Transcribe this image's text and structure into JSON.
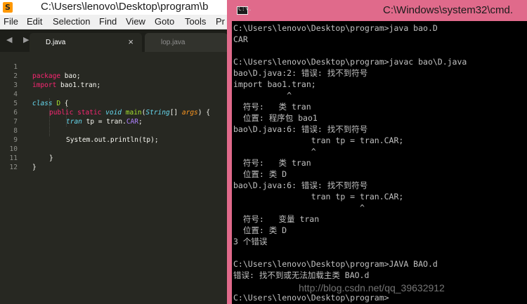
{
  "sublime": {
    "title": "C:\\Users\\lenovo\\Desktop\\program\\b",
    "app_icon": "S",
    "menu": [
      "File",
      "Edit",
      "Selection",
      "Find",
      "View",
      "Goto",
      "Tools",
      "Pr"
    ],
    "nav_arrows": "◀ ▶",
    "tabs": [
      {
        "label": "D.java",
        "close": "×"
      },
      {
        "label": "lop.java"
      }
    ],
    "lines": [
      "1",
      "2",
      "3",
      "4",
      "5",
      "6",
      "7",
      "8",
      "9",
      "10",
      "11",
      "12"
    ],
    "code": {
      "l1_kw": "package",
      "l1_rest": " bao;",
      "l2_kw": "import",
      "l2_rest": " bao1.tran;",
      "l4_kw": "class",
      "l4_name": " D",
      "l4_rest": " {",
      "l5_mod": "public",
      "l5_static": "static",
      "l5_void": "void",
      "l5_fn": "main",
      "l5_type": "String",
      "l5_arr": "[]",
      "l5_arg": "args",
      "l5_rest": ") {",
      "l6_type": "tran",
      "l6_rest": " tp = tran.",
      "l6_const": "CAR",
      "l6_end": ";",
      "l8": "System.out.println(tp);",
      "l10": "}",
      "l12": "}"
    }
  },
  "cmd": {
    "icon_label": "C:\\.",
    "title": "C:\\Windows\\system32\\cmd.",
    "lines": [
      "C:\\Users\\lenovo\\Desktop\\program>java bao.D",
      "CAR",
      "",
      "C:\\Users\\lenovo\\Desktop\\program>javac bao\\D.java",
      "bao\\D.java:2: 错误: 找不到符号",
      "import bao1.tran;",
      "           ^",
      "  符号:   类 tran",
      "  位置: 程序包 bao1",
      "bao\\D.java:6: 错误: 找不到符号",
      "                tran tp = tran.CAR;",
      "                ^",
      "  符号:   类 tran",
      "  位置: 类 D",
      "bao\\D.java:6: 错误: 找不到符号",
      "                tran tp = tran.CAR;",
      "                          ^",
      "  符号:   变量 tran",
      "  位置: 类 D",
      "3 个错误",
      "",
      "C:\\Users\\lenovo\\Desktop\\program>JAVA BAO.d",
      "错误: 找不到或无法加载主类 BAO.d",
      "",
      "C:\\Users\\lenovo\\Desktop\\program>"
    ],
    "watermark": "http://blog.csdn.net/qq_39632912"
  }
}
